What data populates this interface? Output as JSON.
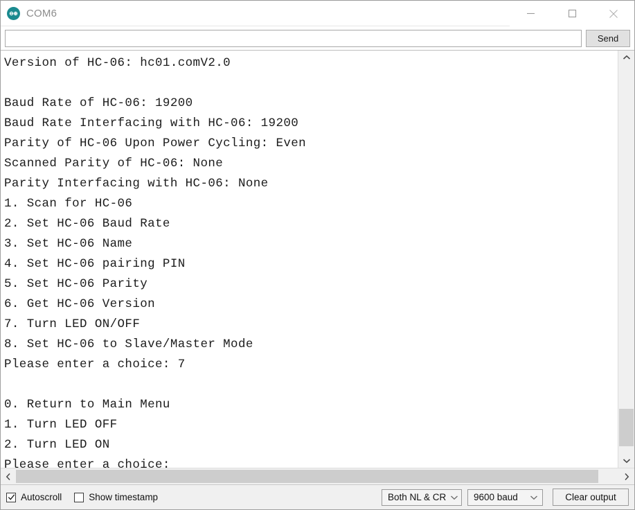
{
  "window": {
    "title": "COM6",
    "icon": "arduino-infinity-icon",
    "controls": {
      "minimize": "minimize-icon",
      "maximize": "maximize-icon",
      "close": "close-icon"
    }
  },
  "sendbar": {
    "input_value": "",
    "input_placeholder": "",
    "send_label": "Send"
  },
  "console": {
    "lines": [
      "Version of HC-06: hc01.comV2.0",
      "",
      "Baud Rate of HC-06: 19200",
      "Baud Rate Interfacing with HC-06: 19200",
      "Parity of HC-06 Upon Power Cycling: Even",
      "Scanned Parity of HC-06: None",
      "Parity Interfacing with HC-06: None",
      "1. Scan for HC-06",
      "2. Set HC-06 Baud Rate",
      "3. Set HC-06 Name",
      "4. Set HC-06 pairing PIN",
      "5. Set HC-06 Parity",
      "6. Get HC-06 Version",
      "7. Turn LED ON/OFF",
      "8. Set HC-06 to Slave/Master Mode",
      "Please enter a choice: 7",
      "",
      "0. Return to Main Menu",
      "1. Turn LED OFF",
      "2. Turn LED ON",
      "Please enter a choice:"
    ],
    "text_color": "#1c1c1c",
    "background": "#ffffff"
  },
  "scrollbars": {
    "vertical": {
      "up_arrow": "chevron-up-icon",
      "down_arrow": "chevron-down-icon",
      "thumb_top_pct": 88.5,
      "thumb_height_pct": 9.5
    },
    "horizontal": {
      "left_arrow": "chevron-left-icon",
      "right_arrow": "chevron-right-icon",
      "thumb_left_pct": 0,
      "thumb_width_pct": 96.5
    }
  },
  "statusbar": {
    "autoscroll": {
      "label": "Autoscroll",
      "checked": true
    },
    "show_timestamp": {
      "label": "Show timestamp",
      "checked": false
    },
    "line_ending": {
      "value": "Both NL & CR"
    },
    "baud_rate": {
      "value": "9600 baud"
    },
    "clear_output": {
      "label": "Clear output"
    }
  }
}
